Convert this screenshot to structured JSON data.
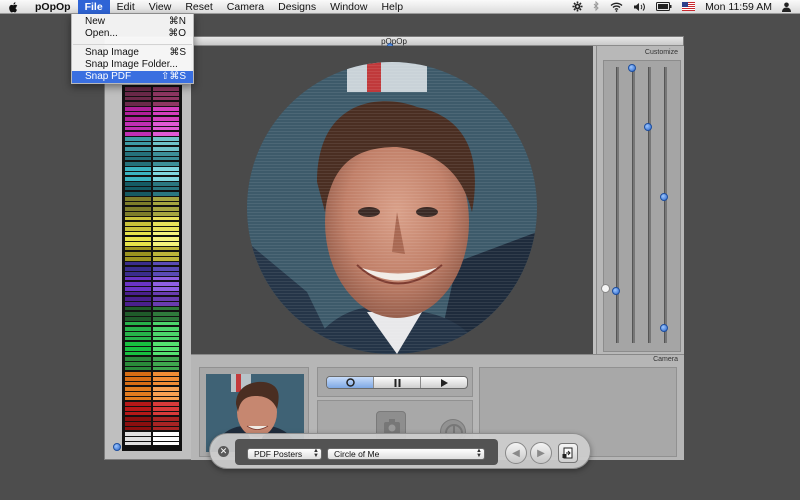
{
  "menubar": {
    "app_name": "pOpOp",
    "menus": [
      "File",
      "Edit",
      "View",
      "Reset",
      "Camera",
      "Designs",
      "Window",
      "Help"
    ],
    "active_menu": "File",
    "clock": "Mon 11:59 AM",
    "status_icons": [
      "gear-icon",
      "bluetooth-icon",
      "wifi-icon",
      "volume-icon",
      "battery-icon",
      "flag-icon",
      "user-icon"
    ]
  },
  "file_menu": {
    "items": [
      {
        "label": "New",
        "shortcut": "⌘N"
      },
      {
        "label": "Open...",
        "shortcut": "⌘O"
      },
      {
        "label": "Snap Image",
        "shortcut": "⌘S"
      },
      {
        "label": "Snap Image Folder...",
        "shortcut": ""
      },
      {
        "label": "Snap PDF",
        "shortcut": "⇧⌘S"
      }
    ],
    "selected_index": 4
  },
  "window": {
    "title": "pOpOp",
    "customize_label": "Customize",
    "camera_label": "Camera",
    "playback": [
      "record",
      "pause",
      "play"
    ]
  },
  "hud": {
    "category": "PDF Posters",
    "design": "Circle of Me",
    "buttons": [
      "previous",
      "next",
      "export"
    ]
  },
  "colors": {
    "menu_highlight": "#3a6fe0",
    "stage_background": "#4a4a4a",
    "window_background": "#bfbfbf"
  }
}
